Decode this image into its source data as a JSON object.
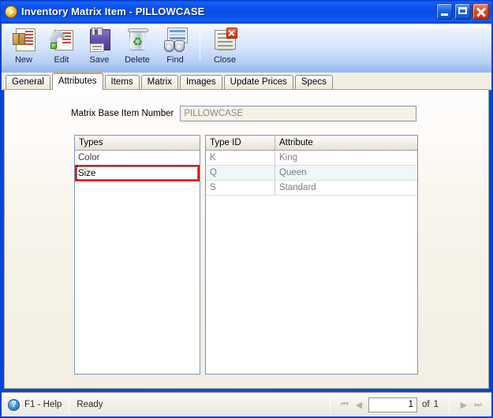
{
  "window": {
    "title": "Inventory Matrix Item - PILLOWCASE",
    "icon": "app-circle-icon",
    "controls": {
      "minimize": "minimize-icon",
      "maximize": "maximize-icon",
      "close": "close-icon"
    }
  },
  "toolbar": {
    "buttons": [
      {
        "label": "New",
        "icon": "new-item-icon"
      },
      {
        "label": "Edit",
        "icon": "wrench-edit-icon"
      },
      {
        "label": "Save",
        "icon": "floppy-disk-save-icon"
      },
      {
        "label": "Delete",
        "icon": "recycle-bin-delete-icon"
      },
      {
        "label": "Find",
        "icon": "binoculars-find-icon"
      },
      {
        "label": "Close",
        "icon": "document-close-icon"
      }
    ]
  },
  "tabs": [
    {
      "label": "General",
      "active": false
    },
    {
      "label": "Attributes",
      "active": true
    },
    {
      "label": "Items",
      "active": false
    },
    {
      "label": "Matrix",
      "active": false
    },
    {
      "label": "Images",
      "active": false
    },
    {
      "label": "Update Prices",
      "active": false
    },
    {
      "label": "Specs",
      "active": false
    }
  ],
  "form": {
    "base_item_label": "Matrix Base Item Number",
    "base_item_value": "PILLOWCASE",
    "base_item_placeholder": ""
  },
  "types_list": {
    "header": "Types",
    "rows": [
      {
        "label": "Color",
        "selected": false
      },
      {
        "label": "Size",
        "selected": true
      }
    ]
  },
  "attributes_grid": {
    "columns": [
      "Type ID",
      "Attribute"
    ],
    "rows": [
      {
        "type_id": "K",
        "attribute": "King"
      },
      {
        "type_id": "Q",
        "attribute": "Queen"
      },
      {
        "type_id": "S",
        "attribute": "Standard"
      }
    ]
  },
  "statusbar": {
    "help_icon": "help-question-icon",
    "help_label": "F1 - Help",
    "status": "Ready",
    "nav": {
      "first": "nav-first-icon",
      "prev": "nav-prev-icon",
      "next": "nav-next-icon",
      "last": "nav-last-icon",
      "page_value": "1",
      "of_label": "of",
      "total": "1"
    }
  },
  "colors": {
    "titlebar_blue": "#0a4ae8",
    "panel_cream": "#f5f2e8",
    "active_tab_accent": "#f0a022",
    "selection_red": "#ee1111",
    "alt_row_blue": "#eef7fa",
    "readonly_field": "#f7f1e6"
  }
}
